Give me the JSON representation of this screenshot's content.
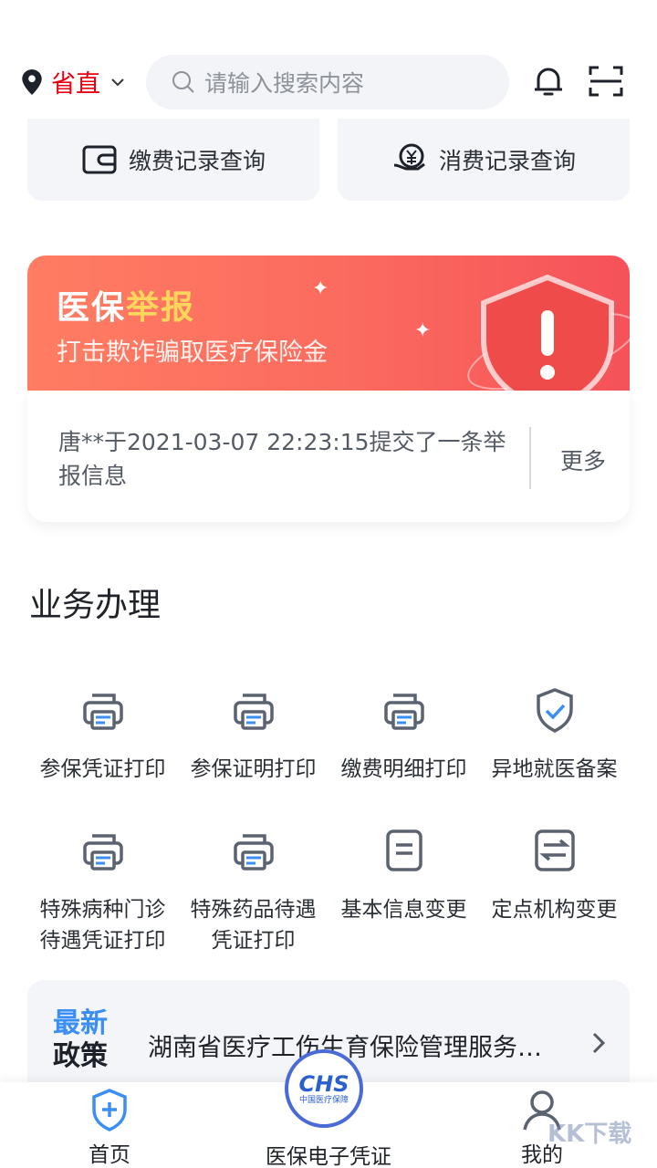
{
  "header": {
    "location": "省直",
    "search_placeholder": "请输入搜索内容"
  },
  "quick_cards": {
    "payment_records": "缴费记录查询",
    "consumption_records": "消费记录查询"
  },
  "report_banner": {
    "title_part1": "医保",
    "title_part2": "举报",
    "subtitle": "打击欺诈骗取医疗保险金"
  },
  "notice": {
    "text": "唐**于2021-03-07 22:23:15提交了一条举报信息",
    "more_label": "更多"
  },
  "business": {
    "title": "业务办理",
    "items": [
      {
        "label_line1": "参保凭证打印",
        "label_line2": "",
        "icon": "printer-icon"
      },
      {
        "label_line1": "参保证明打印",
        "label_line2": "",
        "icon": "printer-icon"
      },
      {
        "label_line1": "缴费明细打印",
        "label_line2": "",
        "icon": "printer-icon"
      },
      {
        "label_line1": "异地就医备案",
        "label_line2": "",
        "icon": "shield-check-icon"
      },
      {
        "label_line1": "特殊病种门诊",
        "label_line2": "待遇凭证打印",
        "icon": "printer-icon"
      },
      {
        "label_line1": "特殊药品待遇",
        "label_line2": "凭证打印",
        "icon": "printer-icon"
      },
      {
        "label_line1": "基本信息变更",
        "label_line2": "",
        "icon": "document-icon"
      },
      {
        "label_line1": "定点机构变更",
        "label_line2": "",
        "icon": "transfer-icon"
      }
    ]
  },
  "policy": {
    "tag_line1": "最新",
    "tag_line2": "政策",
    "text": "湖南省医疗工伤生育保险管理服务…"
  },
  "tabbar": {
    "home": "首页",
    "cert": "医保电子凭证",
    "cert_logo": "CHS",
    "cert_logo_sub": "中国医疗保障",
    "mine": "我的"
  },
  "watermark": "KK下载",
  "colors": {
    "accent_red": "#e60012",
    "icon_blue": "#3a8ef6",
    "banner_start": "#ff7d63",
    "banner_end": "#f5525a"
  }
}
